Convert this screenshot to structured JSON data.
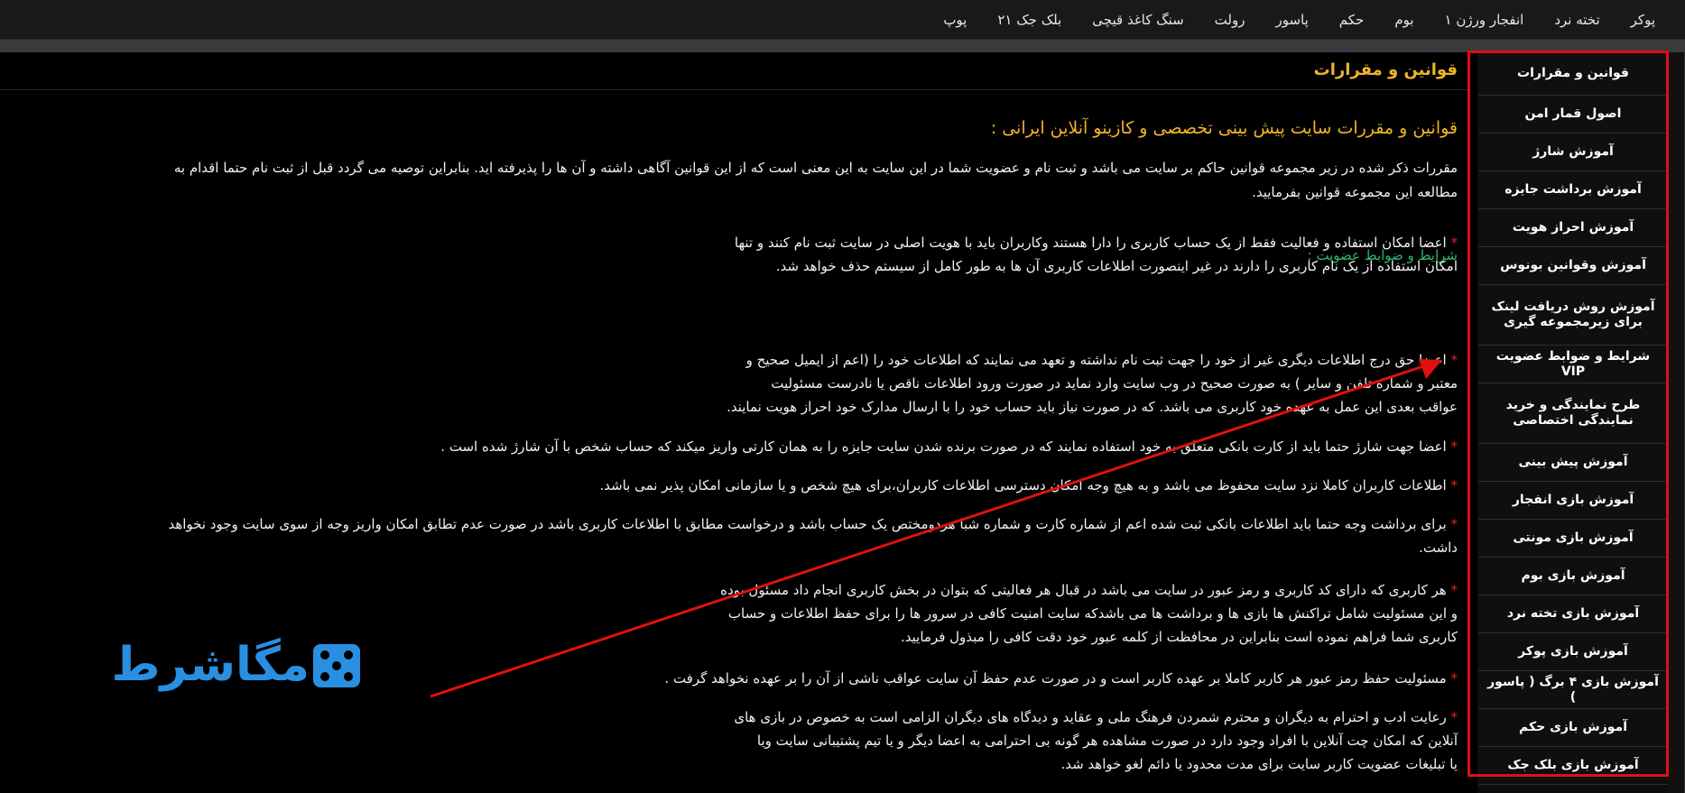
{
  "top_nav": {
    "items": [
      "پوکر",
      "تخته نرد",
      "انفجار ورژن ۱",
      "بوم",
      "حکم",
      "پاسور",
      "رولت",
      "سنگ کاغذ قیچی",
      "بلک جک ۲۱",
      "پوپ"
    ]
  },
  "sidebar": {
    "items": [
      "قوانین و مقرارات",
      "اصول قمار امن",
      "آموزش شارژ",
      "آموزش برداشت جایزه",
      "آموزش احراز هویت",
      "آموزش وقوانین بونوس",
      "آموزش روش دریافت لینک برای زیرمجموعه گیری",
      "شرایط و ضوابط عضویت VIP",
      "طرح نمایندگی و خرید نمایندگی اختصاصی",
      "آموزش پیش بینی",
      "آموزش بازی انفجار",
      "آموزش بازی مونتی",
      "آموزش بازی بوم",
      "آموزش بازی تخته نرد",
      "آموزش بازی پوکر",
      "آموزش بازی ۴ برگ ( پاسور )",
      "آموزش بازی حکم",
      "آموزش بازی بلک جک"
    ]
  },
  "page": {
    "title": "قوانین و مقرارات",
    "heading": "قوانین و مقررات سایت پیش بینی تخصصی و کازینو آنلاین ایرانی :",
    "intro_lines": [
      "مقررات ذکر شده در زیر مجموعه قوانین حاکم بر سایت می باشد و ثبت نام و عضویت شما در این سایت به این معنی است که از این قوانین آگاهی داشته و آن ها را پذیرفته اید. بنابراین توصیه می گردد قبل از ثبت نام حتما اقدام به",
      "مطالعه این مجموعه قوانین بفرمایید."
    ],
    "section_title": "شرایط و ضوابط عضویت :",
    "rules": [
      {
        "star": "*",
        "lines": [
          "اعضا امکان استفاده و فعالیت فقط از یک حساب کاربری را دارا هستند وکاربران باید با هویت اصلی در سایت ثبت نام کنند و تنها",
          "امکان استفاده از یک نام کاربری را دارند در غیر اینصورت اطلاعات کاربری آن ها به طور کامل از سیستم حذف خواهد شد."
        ]
      },
      {
        "star": "*",
        "lines": [
          "اعضا حق درج اطلاعات دیگری غیر از خود را جهت ثبت نام نداشته و تعهد می نمایند که اطلاعات خود را (اعم از ایمیل صحیح و",
          "معتبر و شماره تلفن و سایر ) به صورت صحیح در وب سایت وارد نماید در صورت ورود اطلاعات ناقص یا نادرست مسئولیت",
          "عواقب بعدی این عمل به عهده خود کاربری می باشد. که در صورت نیاز باید حساب خود را با ارسال مدارک خود احراز هویت نمایند."
        ]
      },
      {
        "star": "*",
        "lines": [
          "اعضا جهت شارژ حتما باید از کارت بانکی متعلق به خود استفاده نمایند که در صورت برنده شدن سایت جایزه را به همان کارتی واریز میکند که حساب شخص با آن شارژ شده است ."
        ]
      },
      {
        "star": "*",
        "lines": [
          "اطلاعات کاربران کاملا نزد سایت محفوظ می باشد و به هیچ وجه امکان دسترسی اطلاعات کاربران،برای هیچ شخص و یا سازمانی امکان پذیر نمی باشد."
        ]
      },
      {
        "star": "*",
        "lines": [
          "برای برداشت وجه حتما باید اطلاعات بانکی ثبت شده اعم از شماره کارت و شماره شبا هردومختص یک حساب باشد و درخواست مطابق با اطلاعات کاربری باشد در صورت عدم تطابق امکان واریز وجه از سوی سایت وجود نخواهد",
          "داشت."
        ]
      },
      {
        "star": "*",
        "lines": [
          "هر کاربری که دارای کد کاربری و رمز عبور در سایت می باشد در قبال هر فعالیتی که بتوان در بخش کاربری انجام داد مسئول بوده",
          "و این مسئولیت شامل تراکنش ها بازی ها و برداشت ها می باشدکه سایت امنیت کافی در سرور ها را برای حفظ اطلاعات و حساب",
          "کاربری شما فراهم نموده است بنابراین در محافظت از کلمه عبور خود دقت کافی را مبذول فرمایید."
        ]
      },
      {
        "star": "*",
        "lines": [
          "مسئولیت حفظ رمز عبور هر کاربر کاملا بر عهده کاربر است و در صورت عدم حفظ آن سایت عواقب ناشی از آن را بر عهده نخواهد گرفت ."
        ]
      },
      {
        "star": "*",
        "lines": [
          "رعایت ادب و احترام به دیگران و محترم شمردن فرهنگ ملی و عقاید و دیدگاه های دیگران الزامی است به خصوص در بازی های",
          "آنلاین که امکان چت آنلاین با افراد وجود دارد در صورت مشاهده هر گونه بی احترامی به اعضا دیگر و یا تیم پشتیبانی سایت ویا",
          "یا تبلیغات عضویت کاربر سایت برای مدت محدود یا دائم لغو خواهد شد."
        ]
      }
    ]
  },
  "logo": {
    "text": "مگاشرط",
    "icon": "dice-icon"
  },
  "colors": {
    "accent_gold": "#f0b429",
    "section_green": "#2eb872",
    "star_red": "#e02020",
    "annotation_red": "#e01010",
    "logo_blue": "#2a8fe0"
  }
}
